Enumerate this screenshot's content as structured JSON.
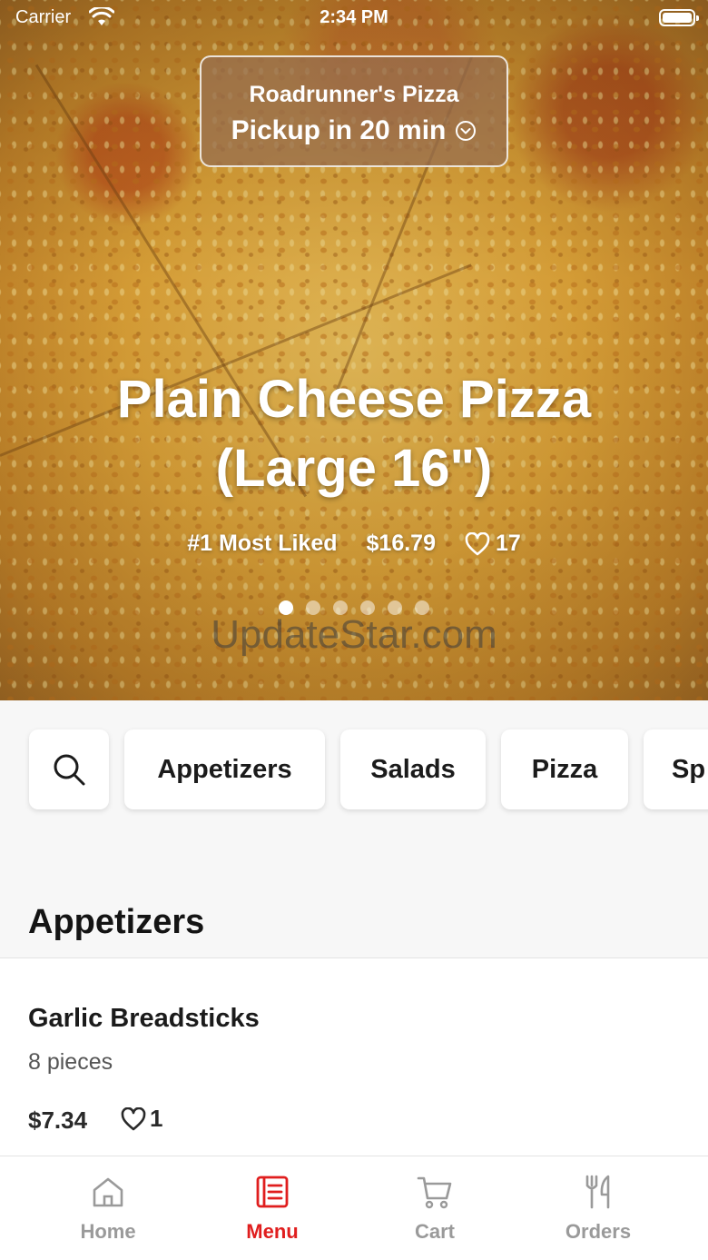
{
  "status_bar": {
    "carrier": "Carrier",
    "time": "2:34 PM"
  },
  "header": {
    "restaurant": "Roadrunner's Pizza",
    "pickup": "Pickup in 20 min"
  },
  "featured": {
    "title_line1": "Plain Cheese Pizza",
    "title_line2": "(Large 16\")",
    "badge": "#1 Most Liked",
    "price": "$16.79",
    "likes": "17",
    "carousel_pages": 6,
    "carousel_active_index": 0
  },
  "watermark": "UpdateStar.com",
  "categories": {
    "search_icon": "search-icon",
    "items": [
      "Appetizers",
      "Salads",
      "Pizza",
      "Sp"
    ]
  },
  "section": {
    "title": "Appetizers"
  },
  "menu_items": [
    {
      "name": "Garlic Breadsticks",
      "description": "8 pieces",
      "price": "$7.34",
      "likes": "1"
    }
  ],
  "tabbar": {
    "tabs": [
      {
        "label": "Home",
        "icon": "home-icon",
        "active": false
      },
      {
        "label": "Menu",
        "icon": "menu-icon",
        "active": true
      },
      {
        "label": "Cart",
        "icon": "cart-icon",
        "active": false
      },
      {
        "label": "Orders",
        "icon": "orders-icon",
        "active": false
      }
    ]
  },
  "colors": {
    "accent": "#e01e1e",
    "inactive_tab": "#9a9a9a",
    "pickup_bg": "#96704f"
  }
}
